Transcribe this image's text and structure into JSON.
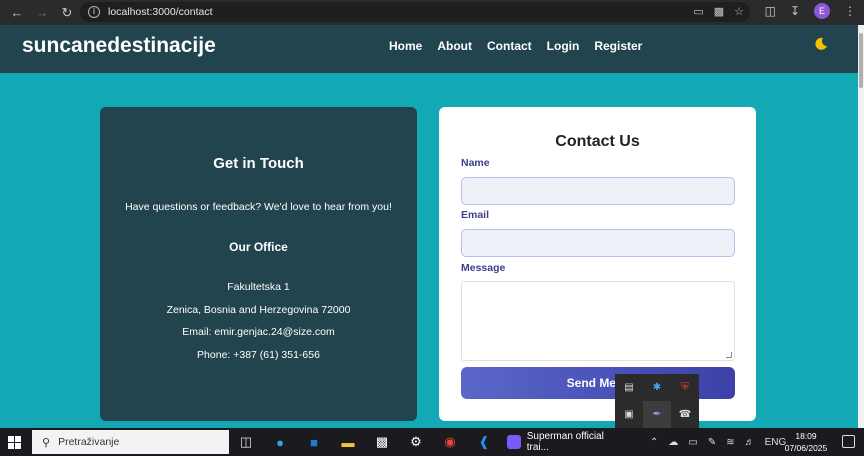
{
  "browser": {
    "back_icon": "arrow-left-icon",
    "forward_icon": "arrow-right-icon",
    "reload_icon": "reload-icon",
    "url": "localhost:3000/contact",
    "profile_initial": "E"
  },
  "site": {
    "brand": "suncanedestinacije",
    "nav": [
      "Home",
      "About",
      "Contact",
      "Login",
      "Register"
    ],
    "theme_icon": "moon-icon",
    "accent_color": "#12a8b4",
    "header_color": "#22444f"
  },
  "info": {
    "title": "Get in Touch",
    "lead": "Have questions or feedback? We'd love to hear from you!",
    "office_title": "Our Office",
    "address_line1": "Fakultetska 1",
    "address_line2": "Zenica, Bosnia and Herzegovina 72000",
    "email": "Email: emir.genjac.24@size.com",
    "phone": "Phone: +387 (61) 351-656"
  },
  "form": {
    "title": "Contact Us",
    "name_label": "Name",
    "email_label": "Email",
    "message_label": "Message",
    "submit_label": "Send Mess"
  },
  "taskbar": {
    "search_placeholder": "Pretraživanje",
    "active_app": "Superman official trai...",
    "language": "ENG",
    "time": "18:09",
    "date": "07/06/2025"
  }
}
